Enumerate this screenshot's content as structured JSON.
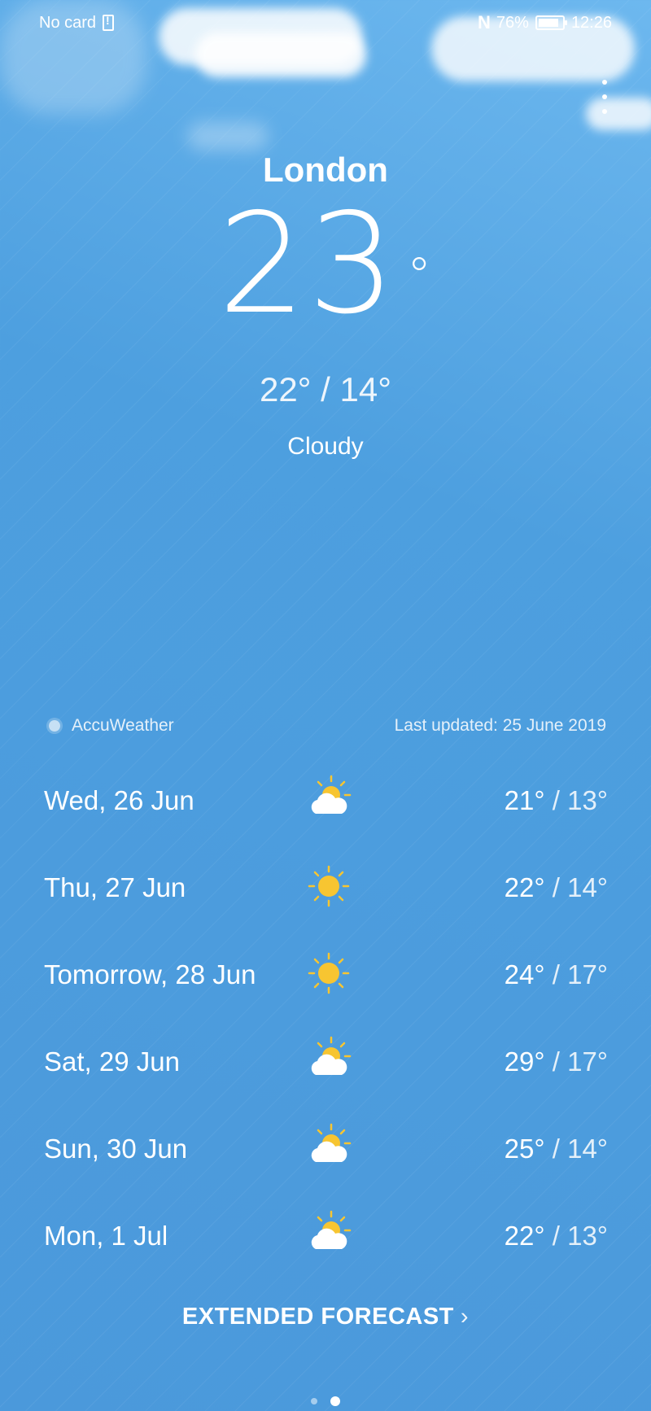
{
  "status_bar": {
    "carrier": "No card",
    "battery": "76%",
    "time": "12:26"
  },
  "current": {
    "city": "London",
    "temperature": "23",
    "degree_symbol": "°",
    "high": "22°",
    "low": "14°",
    "separator": " / ",
    "condition": "Cloudy"
  },
  "provider": {
    "name": "AccuWeather",
    "last_updated": "Last updated: 25 June 2019"
  },
  "forecast": [
    {
      "day": "Wed, 26 Jun",
      "icon": "partly-cloudy-icon",
      "high": "21°",
      "low": "13°"
    },
    {
      "day": "Thu, 27 Jun",
      "icon": "sunny-icon",
      "high": "22°",
      "low": "14°"
    },
    {
      "day": "Tomorrow, 28 Jun",
      "icon": "sunny-icon",
      "high": "24°",
      "low": "17°"
    },
    {
      "day": "Sat, 29 Jun",
      "icon": "partly-cloudy-icon",
      "high": "29°",
      "low": "17°"
    },
    {
      "day": "Sun, 30 Jun",
      "icon": "partly-cloudy-icon",
      "high": "25°",
      "low": "14°"
    },
    {
      "day": "Mon, 1 Jul",
      "icon": "partly-cloudy-icon",
      "high": "22°",
      "low": "13°"
    }
  ],
  "extended_forecast_label": "EXTENDED FORECAST",
  "colors": {
    "sky_top": "#6db8ef",
    "sky_bottom": "#4b99db",
    "sun": "#f7c531",
    "cloud": "#ffffff"
  }
}
